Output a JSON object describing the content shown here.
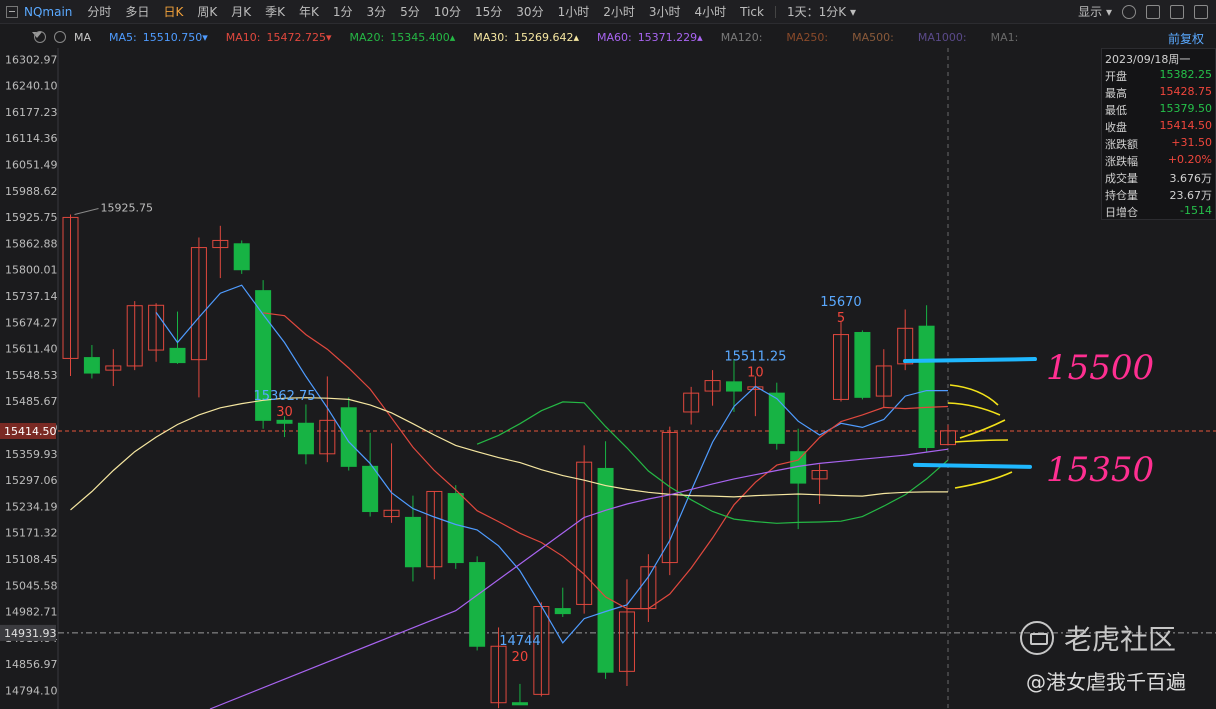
{
  "toolbar": {
    "symbol": "NQmain",
    "periods": [
      "分时",
      "多日",
      "日K",
      "周K",
      "月K",
      "季K",
      "年K",
      "1分",
      "3分",
      "5分",
      "10分",
      "15分",
      "30分",
      "1小时",
      "2小时",
      "3小时",
      "4小时",
      "Tick"
    ],
    "active_period": "日K",
    "range_select": "1天：1分K",
    "display_label": "显示"
  },
  "ma_legend": {
    "indicator": "MA",
    "items": [
      {
        "label": "MA5:",
        "value": "15510.750",
        "arrow": "▾",
        "color": "#4f9cff"
      },
      {
        "label": "MA10:",
        "value": "15472.725",
        "arrow": "▾",
        "color": "#e0483e"
      },
      {
        "label": "MA20:",
        "value": "15345.400",
        "arrow": "▴",
        "color": "#25b845"
      },
      {
        "label": "MA30:",
        "value": "15269.642",
        "arrow": "▴",
        "color": "#f5e6a0"
      },
      {
        "label": "MA60:",
        "value": "15371.229",
        "arrow": "▴",
        "color": "#a864f0"
      },
      {
        "label": "MA120:",
        "value": "",
        "arrow": "",
        "color": "#7a7a7a"
      },
      {
        "label": "MA250:",
        "value": "",
        "arrow": "",
        "color": "#8a4a2a"
      },
      {
        "label": "MA500:",
        "value": "",
        "arrow": "",
        "color": "#8a5a3a"
      },
      {
        "label": "MA1000:",
        "value": "",
        "arrow": "",
        "color": "#5a4a8a"
      },
      {
        "label": "MA1:",
        "value": "",
        "arrow": "",
        "color": "#6a6a6a"
      }
    ],
    "restore_label": "前复权"
  },
  "info_panel": {
    "date": "2023/09/18周一",
    "rows": [
      {
        "k": "开盘",
        "v": "15382.25",
        "color": "#25c04a"
      },
      {
        "k": "最高",
        "v": "15428.75",
        "color": "#f0463c"
      },
      {
        "k": "最低",
        "v": "15379.50",
        "color": "#25c04a"
      },
      {
        "k": "收盘",
        "v": "15414.50",
        "color": "#f0463c"
      },
      {
        "k": "涨跌额",
        "v": "+31.50",
        "color": "#f0463c"
      },
      {
        "k": "涨跌幅",
        "v": "+0.20%",
        "color": "#f0463c"
      },
      {
        "k": "成交量",
        "v": "3.676万",
        "color": "#d2d2d2"
      },
      {
        "k": "持仓量",
        "v": "23.67万",
        "color": "#d2d2d2"
      },
      {
        "k": "日增仓",
        "v": "-1514",
        "color": "#25c04a"
      }
    ]
  },
  "chart_data": {
    "type": "candlestick",
    "ylim": [
      14750,
      16330
    ],
    "y_ticks": [
      "16302.97",
      "16240.10",
      "16177.23",
      "16114.36",
      "16051.49",
      "15988.62",
      "15925.75",
      "15862.88",
      "15800.01",
      "15737.14",
      "15674.27",
      "15611.40",
      "15548.53",
      "15485.67",
      "15422.80",
      "15359.93",
      "15297.06",
      "15234.19",
      "15171.32",
      "15108.45",
      "15045.58",
      "14982.71",
      "14919.84",
      "14856.97",
      "14794.10"
    ],
    "current_price_label": "15414.50",
    "cursor_price_label": "14931.93",
    "candles": [
      {
        "o": 15588,
        "h": 15932,
        "l": 15546,
        "c": 15925
      },
      {
        "o": 15590,
        "h": 15620,
        "l": 15540,
        "c": 15553
      },
      {
        "o": 15560,
        "h": 15610,
        "l": 15522,
        "c": 15570
      },
      {
        "o": 15570,
        "h": 15725,
        "l": 15560,
        "c": 15714
      },
      {
        "o": 15608,
        "h": 15720,
        "l": 15580,
        "c": 15715
      },
      {
        "o": 15612,
        "h": 15700,
        "l": 15575,
        "c": 15578
      },
      {
        "o": 15585,
        "h": 15877,
        "l": 15495,
        "c": 15853
      },
      {
        "o": 15853,
        "h": 15905,
        "l": 15780,
        "c": 15870
      },
      {
        "o": 15862,
        "h": 15870,
        "l": 15790,
        "c": 15800
      },
      {
        "o": 15750,
        "h": 15775,
        "l": 15420,
        "c": 15440
      },
      {
        "o": 15440,
        "h": 15450,
        "l": 15400,
        "c": 15433
      },
      {
        "o": 15433,
        "h": 15478,
        "l": 15335,
        "c": 15360
      },
      {
        "o": 15360,
        "h": 15545,
        "l": 15340,
        "c": 15440
      },
      {
        "o": 15470,
        "h": 15495,
        "l": 15320,
        "c": 15330
      },
      {
        "o": 15330,
        "h": 15410,
        "l": 15210,
        "c": 15222
      },
      {
        "o": 15210,
        "h": 15385,
        "l": 15195,
        "c": 15225
      },
      {
        "o": 15208,
        "h": 15260,
        "l": 15055,
        "c": 15090
      },
      {
        "o": 15090,
        "h": 15270,
        "l": 15060,
        "c": 15270
      },
      {
        "o": 15265,
        "h": 15285,
        "l": 15085,
        "c": 15100
      },
      {
        "o": 15100,
        "h": 15115,
        "l": 14890,
        "c": 14900
      },
      {
        "o": 14765,
        "h": 14945,
        "l": 14752,
        "c": 14900
      },
      {
        "o": 14765,
        "h": 14810,
        "l": 14760,
        "c": 14760
      },
      {
        "o": 14785,
        "h": 15005,
        "l": 14780,
        "c": 14995
      },
      {
        "o": 14990,
        "h": 15040,
        "l": 14970,
        "c": 14978
      },
      {
        "o": 15000,
        "h": 15380,
        "l": 14978,
        "c": 15340
      },
      {
        "o": 15325,
        "h": 15390,
        "l": 14822,
        "c": 14838
      },
      {
        "o": 14840,
        "h": 15060,
        "l": 14805,
        "c": 14982
      },
      {
        "o": 14990,
        "h": 15120,
        "l": 14958,
        "c": 15090
      },
      {
        "o": 15100,
        "h": 15425,
        "l": 15070,
        "c": 15411
      },
      {
        "o": 15460,
        "h": 15520,
        "l": 15430,
        "c": 15505
      },
      {
        "o": 15510,
        "h": 15560,
        "l": 15475,
        "c": 15535
      },
      {
        "o": 15532,
        "h": 15585,
        "l": 15460,
        "c": 15510
      },
      {
        "o": 15514,
        "h": 15545,
        "l": 15450,
        "c": 15520
      },
      {
        "o": 15505,
        "h": 15530,
        "l": 15370,
        "c": 15385
      },
      {
        "o": 15365,
        "h": 15420,
        "l": 15180,
        "c": 15290
      },
      {
        "o": 15300,
        "h": 15335,
        "l": 15240,
        "c": 15320
      },
      {
        "o": 15490,
        "h": 15675,
        "l": 15485,
        "c": 15645
      },
      {
        "o": 15650,
        "h": 15655,
        "l": 15490,
        "c": 15495
      },
      {
        "o": 15498,
        "h": 15610,
        "l": 15470,
        "c": 15570
      },
      {
        "o": 15575,
        "h": 15705,
        "l": 15560,
        "c": 15660
      },
      {
        "o": 15665,
        "h": 15715,
        "l": 15365,
        "c": 15375
      },
      {
        "o": 15382,
        "h": 15429,
        "l": 15380,
        "c": 15415
      }
    ],
    "series": [
      {
        "name": "MA5",
        "color": "#4f9cff",
        "values": [
          null,
          null,
          null,
          null,
          15698,
          15626,
          15686,
          15744,
          15763,
          15693,
          15626,
          15545,
          15470,
          15389,
          15337,
          15267,
          15229,
          15209,
          15191,
          15178,
          15140,
          15080,
          14996,
          14908,
          14966,
          14983,
          14999,
          15066,
          15153,
          15272,
          15388,
          15473,
          15521,
          15492,
          15438,
          15405,
          15433,
          15423,
          15442,
          15498,
          15511,
          15511
        ]
      },
      {
        "name": "MA10",
        "color": "#e0483e",
        "values": [
          null,
          null,
          null,
          null,
          null,
          null,
          null,
          null,
          null,
          15697,
          15690,
          15645,
          15610,
          15565,
          15515,
          15446,
          15376,
          15320,
          15274,
          15224,
          15198,
          15170,
          15148,
          15115,
          15072,
          15018,
          14990,
          14990,
          15025,
          15087,
          15159,
          15238,
          15292,
          15333,
          15345,
          15399,
          15437,
          15453,
          15471,
          15468,
          15471,
          15473
        ]
      },
      {
        "name": "MA20",
        "color": "#25b845",
        "values": [
          null,
          null,
          null,
          null,
          null,
          null,
          null,
          null,
          null,
          null,
          null,
          null,
          null,
          null,
          null,
          null,
          null,
          null,
          null,
          15383,
          15404,
          15432,
          15463,
          15484,
          15482,
          15425,
          15374,
          15319,
          15281,
          15250,
          15222,
          15204,
          15198,
          15194,
          15196,
          15197,
          15199,
          15210,
          15235,
          15262,
          15300,
          15345
        ]
      },
      {
        "name": "MA30",
        "color": "#f5e6a0",
        "values": [
          15226,
          15270,
          15320,
          15365,
          15400,
          15430,
          15453,
          15470,
          15480,
          15488,
          15493,
          15494,
          15493,
          15490,
          15477,
          15458,
          15432,
          15405,
          15380,
          15365,
          15351,
          15339,
          15322,
          15308,
          15297,
          15284,
          15275,
          15268,
          15263,
          15260,
          15259,
          15257,
          15260,
          15262,
          15264,
          15262,
          15260,
          15259,
          15265,
          15268,
          15269,
          15269
        ]
      },
      {
        "name": "MA60",
        "color": "#a864f0",
        "values": [
          null,
          null,
          null,
          null,
          null,
          null,
          null,
          null,
          null,
          null,
          null,
          null,
          null,
          null,
          null,
          null,
          null,
          null,
          null,
          null,
          null,
          null,
          null,
          null,
          15208,
          15225,
          15240,
          15252,
          15262,
          15275,
          15288,
          15300,
          15310,
          15320,
          15330,
          15337,
          15342,
          15347,
          15352,
          15357,
          15364,
          15371
        ]
      }
    ],
    "annotations": [
      {
        "price": "15925.75",
        "index": 0
      },
      {
        "price": "15362.75",
        "count": "30",
        "index": 10
      },
      {
        "price": "14744",
        "count": "20",
        "index": 21
      },
      {
        "price": "15511.25",
        "count": "10",
        "index": 32
      },
      {
        "price": "15670",
        "count": "5",
        "index": 36
      }
    ],
    "handwritten": [
      {
        "text": "15500",
        "price": 15510
      },
      {
        "text": "15350",
        "price": 15348
      }
    ]
  },
  "watermark": {
    "brand": "老虎社区",
    "author": "@港女虐我千百遍"
  }
}
